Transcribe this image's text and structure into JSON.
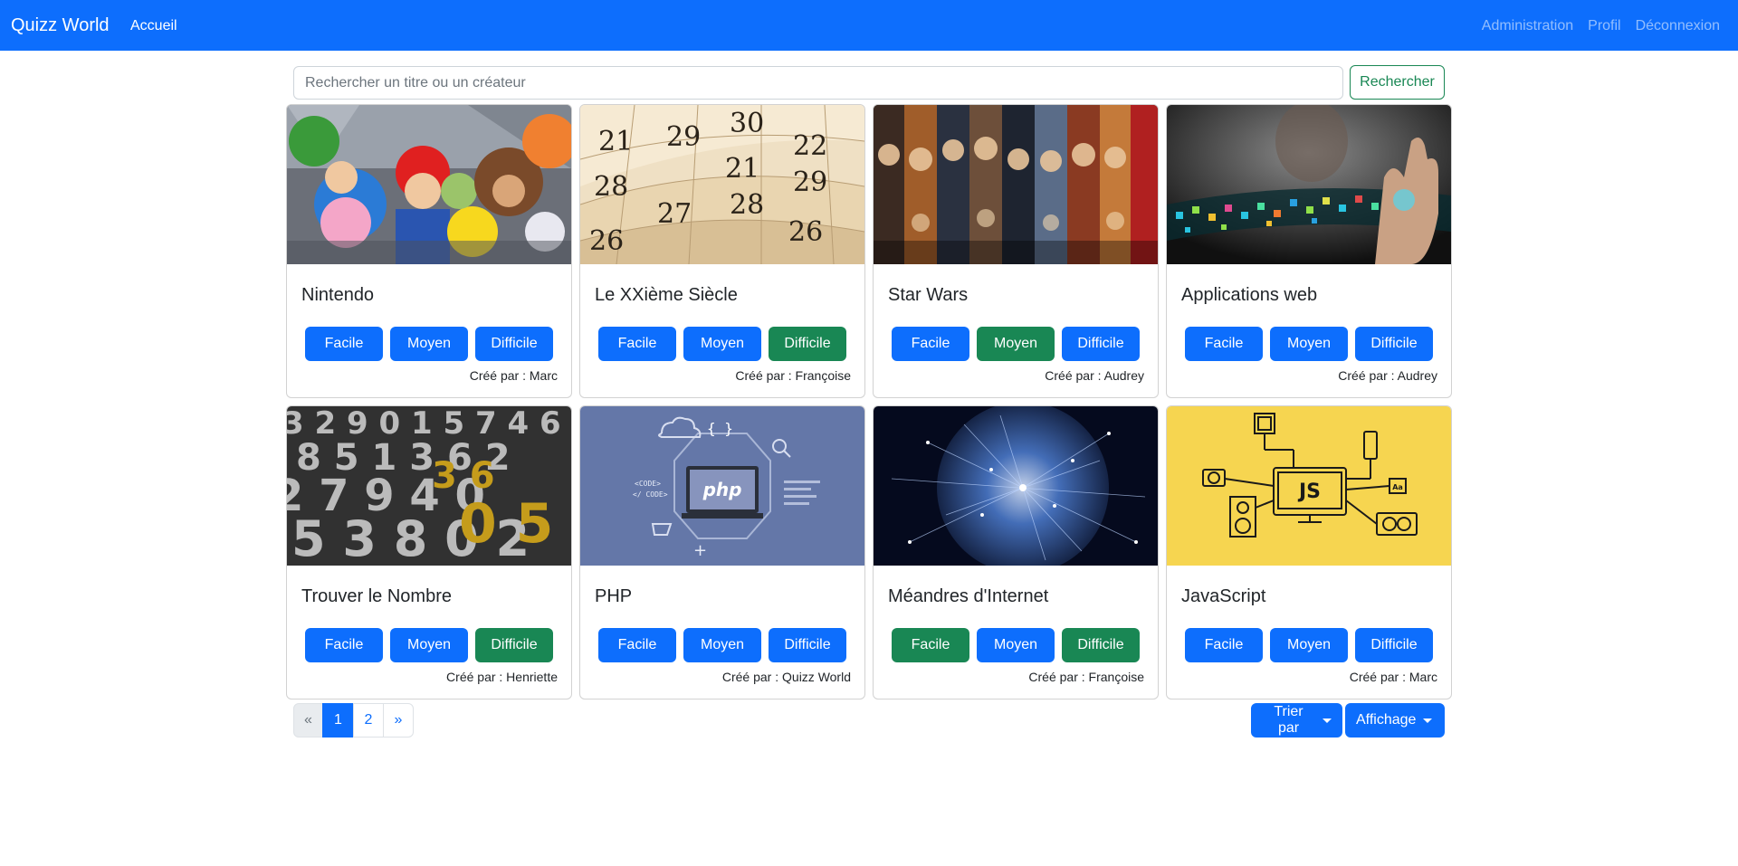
{
  "navbar": {
    "brand": "Quizz World",
    "home": "Accueil",
    "admin": "Administration",
    "profile": "Profil",
    "logout": "Déconnexion"
  },
  "search": {
    "placeholder": "Rechercher un titre ou un créateur",
    "button": "Rechercher"
  },
  "difficulty_labels": [
    "Facile",
    "Moyen",
    "Difficile"
  ],
  "colors": {
    "primary": "#0d6efd",
    "success": "#198754"
  },
  "quizzes": [
    {
      "title": "Nintendo",
      "author": "Créé par : Marc",
      "image": "nintendo-characters",
      "completed": [
        false,
        false,
        false
      ]
    },
    {
      "title": "Le XXième Siècle",
      "author": "Créé par : Françoise",
      "image": "calendar",
      "completed": [
        false,
        false,
        true
      ]
    },
    {
      "title": "Star Wars",
      "author": "Créé par : Audrey",
      "image": "star-wars-posters",
      "completed": [
        false,
        true,
        false
      ]
    },
    {
      "title": "Applications web",
      "author": "Créé par : Audrey",
      "image": "hand-with-app-icons",
      "completed": [
        false,
        false,
        false
      ]
    },
    {
      "title": "Trouver le Nombre",
      "author": "Créé par : Henriette",
      "image": "numbers",
      "completed": [
        false,
        false,
        true
      ]
    },
    {
      "title": "PHP",
      "author": "Créé par : Quizz World",
      "image": "php-laptop",
      "completed": [
        false,
        false,
        false
      ]
    },
    {
      "title": "Méandres d'Internet",
      "author": "Créé par : Françoise",
      "image": "network-globe",
      "completed": [
        true,
        false,
        true
      ]
    },
    {
      "title": "JavaScript",
      "author": "Créé par : Marc",
      "image": "javascript-devices",
      "completed": [
        false,
        false,
        false
      ]
    }
  ],
  "pagination": {
    "prev": "«",
    "pages": [
      "1",
      "2"
    ],
    "current": "1",
    "next": "»"
  },
  "sort_button": "Trier par",
  "display_button": "Affichage"
}
